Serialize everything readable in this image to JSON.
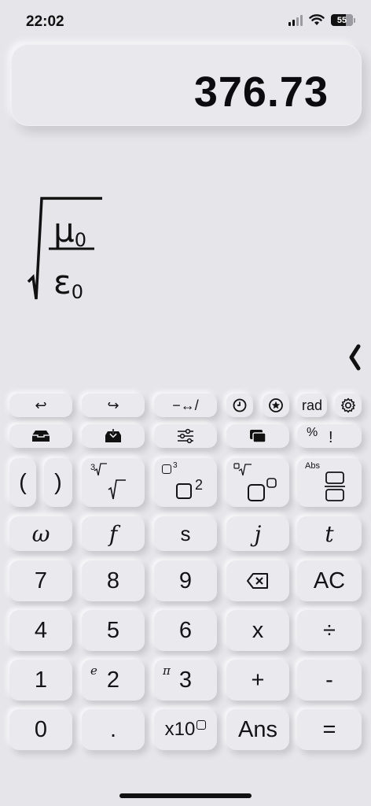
{
  "status": {
    "time": "22:02",
    "battery": "55"
  },
  "display": {
    "result": "376.73"
  },
  "expression": {
    "numerator_symbol": "μ",
    "numerator_sub": "0",
    "denominator_symbol": "ε",
    "denominator_sub": "0"
  },
  "toolbar": {
    "redo_left": "↩",
    "redo_right": "↪",
    "convert": "−↔/",
    "history": "history-icon",
    "favorites": "star-icon",
    "angle_mode": "rad",
    "settings": "gear-icon"
  },
  "toolbar2": {
    "inbox": "inbox-icon",
    "save": "save-icon",
    "sliders": "sliders-icon",
    "windows": "windows-icon",
    "percent": "%",
    "factorial": "!"
  },
  "functions": {
    "paren_open": "(",
    "paren_close": ")",
    "cube_root_index": "3",
    "power3_label": "3",
    "power2_label": "2",
    "abs_label": "Abs"
  },
  "variables": [
    "ω",
    "f",
    "s",
    "j",
    "t"
  ],
  "keypad": {
    "row1": [
      "7",
      "8",
      "9",
      "⌫",
      "AC"
    ],
    "row2": [
      "4",
      "5",
      "6",
      "x",
      "÷"
    ],
    "row3": [
      "1",
      "2",
      "3",
      "+",
      "-"
    ],
    "row4": [
      "0",
      ".",
      "x10",
      "Ans",
      "="
    ],
    "e_label": "e",
    "pi_label": "π"
  }
}
